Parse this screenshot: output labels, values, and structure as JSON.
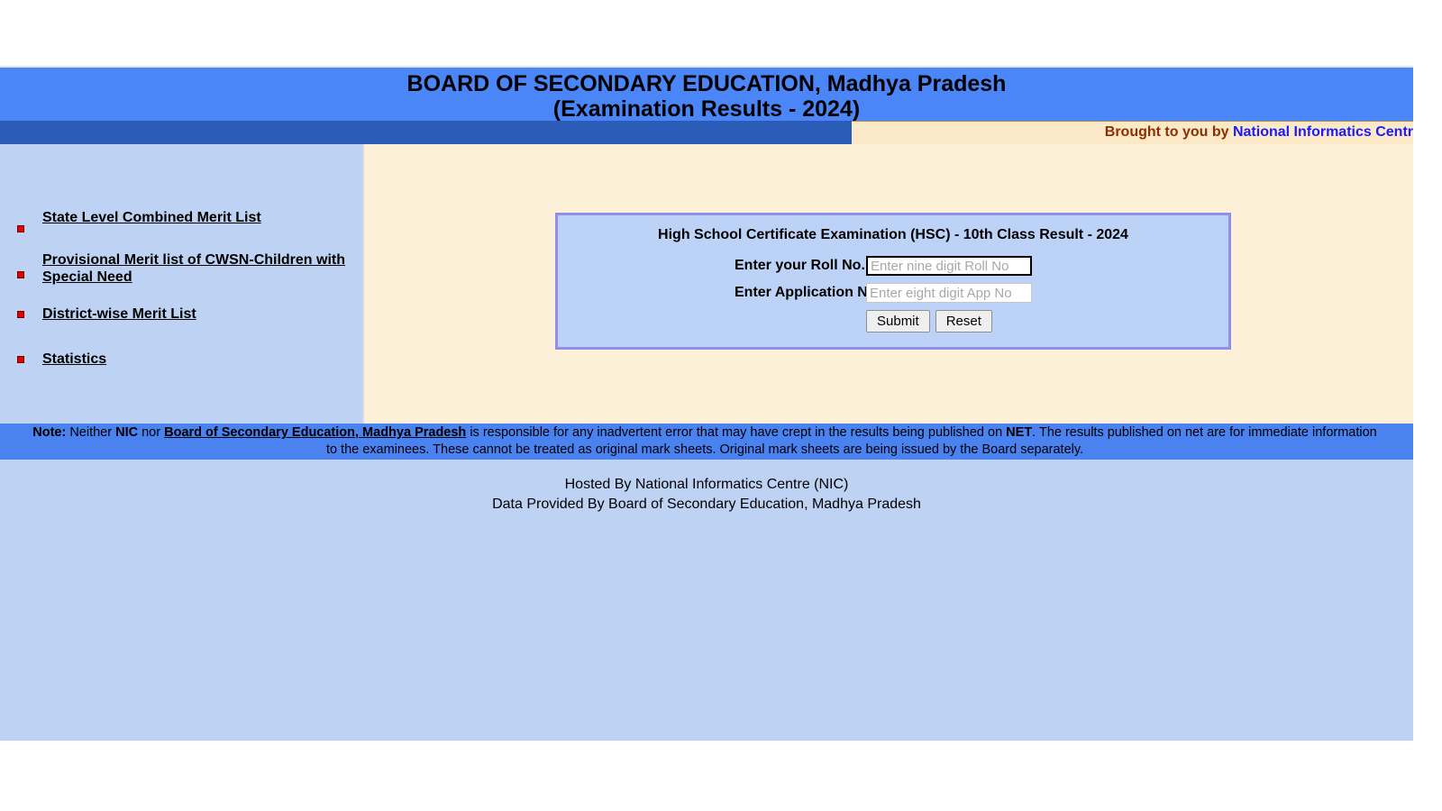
{
  "header": {
    "title_line_1": "BOARD OF SECONDARY EDUCATION, Madhya Pradesh",
    "title_line_2": "(Examination Results - 2024)"
  },
  "brought_to_you": {
    "prefix": "Brought to you by ",
    "link": "National Informatics Centr"
  },
  "sidebar": {
    "items": [
      {
        "label": "State Level Combined Merit List"
      },
      {
        "label": "Provisional Merit list of CWSN-Children with Special Need"
      },
      {
        "label": "District-wise Merit List"
      },
      {
        "label": "Statistics"
      }
    ]
  },
  "form": {
    "title": "High School Certificate Examination (HSC) - 10th Class Result - 2024",
    "roll_label": "Enter your Roll No.",
    "roll_placeholder": "Enter nine digit Roll No",
    "roll_value": "",
    "app_label": "Enter Application No.",
    "app_placeholder": "Enter eight digit App No",
    "app_value": "",
    "submit_label": "Submit",
    "reset_label": "Reset"
  },
  "note": {
    "prefix": "Note:",
    "part_1": " Neither ",
    "bold_1": "NIC",
    "part_2": " nor ",
    "link_1": "Board of Secondary Education, Madhya Pradesh",
    "part_3": " is responsible for any inadvertent error that may have crept in the results being published on ",
    "bold_2": "NET",
    "part_4": ". The results published on net are for immediate information",
    "line_2": "to the examinees. These cannot be treated as original mark sheets. Original mark sheets are being issued by the Board separately."
  },
  "footer": {
    "line_1": "Hosted By National Informatics Centre (NIC)",
    "line_2": "Data Provided By Board of Secondary Education, Madhya Pradesh"
  },
  "colors": {
    "header_blue": "#4a86f7",
    "bar_dark_blue": "#2a5cb8",
    "sidebar_blue": "#bed2f4",
    "main_cream": "#fdf0d9",
    "strip_cream": "#fbe9c8",
    "note_blue": "#4a82f0",
    "panel_border": "#8f8fe8",
    "bullet_red": "#e50000",
    "link_blue": "#1a1aff",
    "btyb_brown": "#8b2f00"
  }
}
